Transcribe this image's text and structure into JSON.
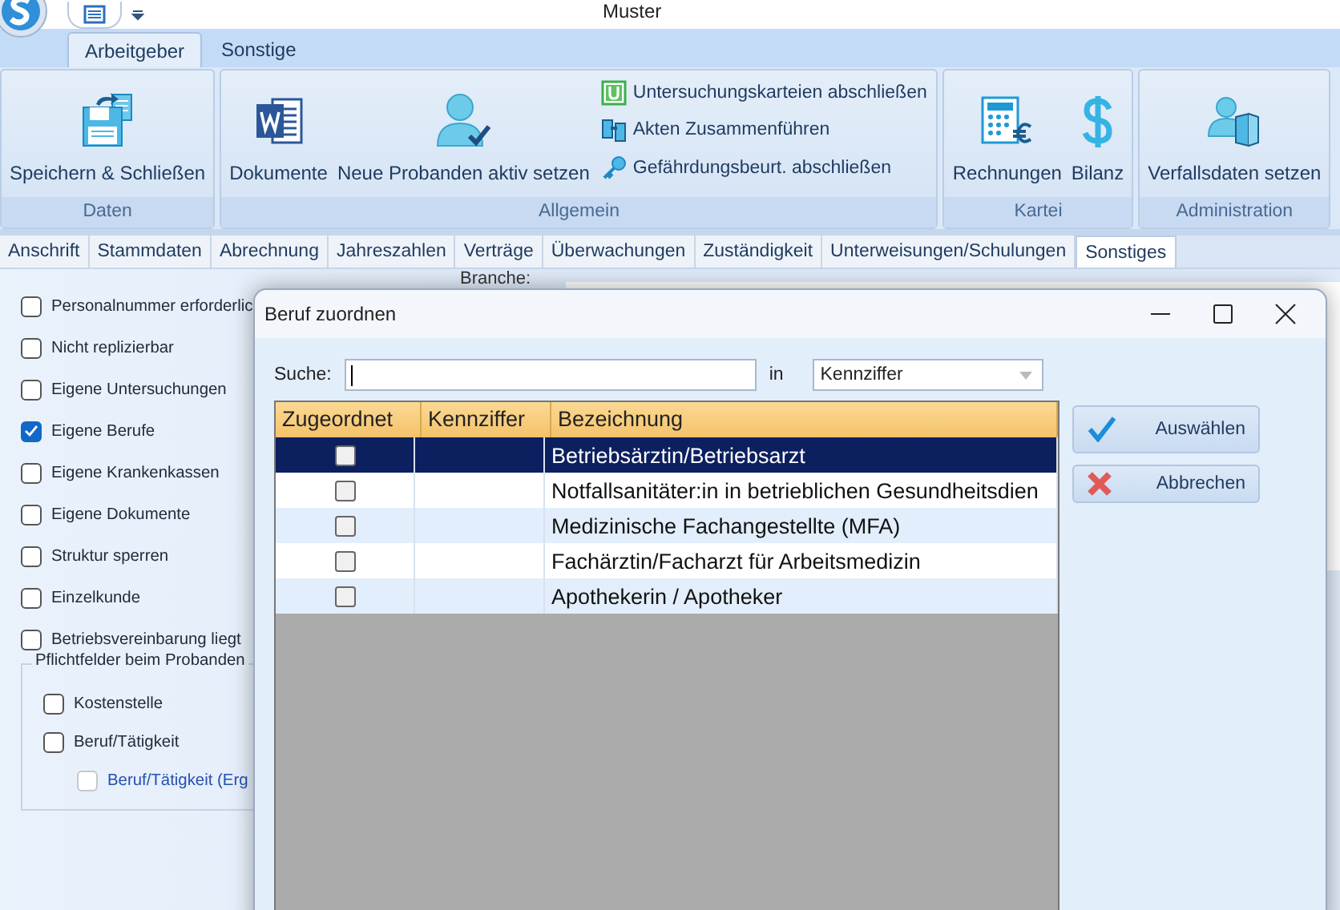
{
  "window": {
    "title": "Muster"
  },
  "ribbon_tabs": [
    {
      "label": "Arbeitgeber",
      "selected": true
    },
    {
      "label": "Sonstige",
      "selected": false
    }
  ],
  "ribbon_groups": [
    {
      "label": "Daten",
      "large": [
        {
          "label": "Speichern & Schließen"
        }
      ]
    },
    {
      "label": "Allgemein",
      "large": [
        {
          "label": "Dokumente"
        },
        {
          "label": "Neue Probanden aktiv setzen"
        }
      ],
      "small": [
        {
          "label": "Untersuchungskarteien abschließen"
        },
        {
          "label": "Akten Zusammenführen"
        },
        {
          "label": "Gefährdungsbeurt. abschließen"
        }
      ]
    },
    {
      "label": "Kartei",
      "large": [
        {
          "label": "Rechnungen"
        },
        {
          "label": "Bilanz"
        }
      ]
    },
    {
      "label": "Administration",
      "large": [
        {
          "label": "Verfallsdaten setzen"
        }
      ]
    }
  ],
  "page_tabs": [
    {
      "label": "Anschrift",
      "selected": false
    },
    {
      "label": "Stammdaten",
      "selected": false
    },
    {
      "label": "Abrechnung",
      "selected": false
    },
    {
      "label": "Jahreszahlen",
      "selected": false
    },
    {
      "label": "Verträge",
      "selected": false
    },
    {
      "label": "Überwachungen",
      "selected": false
    },
    {
      "label": "Zuständigkeit",
      "selected": false
    },
    {
      "label": "Unterweisungen/Schulungen",
      "selected": false
    },
    {
      "label": "Sonstiges",
      "selected": true
    }
  ],
  "options": [
    {
      "label": "Personalnummer erforderlic",
      "checked": false
    },
    {
      "label": "Nicht replizierbar",
      "checked": false
    },
    {
      "label": "Eigene Untersuchungen",
      "checked": false
    },
    {
      "label": "Eigene Berufe",
      "checked": true
    },
    {
      "label": "Eigene Krankenkassen",
      "checked": false
    },
    {
      "label": "Eigene Dokumente",
      "checked": false
    },
    {
      "label": "Struktur sperren",
      "checked": false
    },
    {
      "label": "Einzelkunde",
      "checked": false
    },
    {
      "label": "Betriebsvereinbarung liegt",
      "checked": false
    }
  ],
  "required_fields": {
    "title": "Pflichtfelder beim Probanden",
    "items": [
      {
        "label": "Kostenstelle",
        "checked": false,
        "disabled": false
      },
      {
        "label": "Beruf/Tätigkeit",
        "checked": false,
        "disabled": false,
        "children": [
          {
            "label": "Beruf/Tätigkeit (Erg",
            "checked": false,
            "disabled": true
          }
        ]
      }
    ]
  },
  "branche_label": "Branche:",
  "dialog": {
    "title": "Beruf zuordnen",
    "search": {
      "label": "Suche:",
      "in_label": "in",
      "field": "Kennziffer"
    },
    "columns": [
      "Zugeordnet",
      "Kennziffer",
      "Bezeichnung"
    ],
    "rows": [
      {
        "checked": false,
        "selected": true,
        "bezeichnung": "Betriebsärztin/Betriebsarzt"
      },
      {
        "checked": false,
        "selected": false,
        "bezeichnung": "Notfallsanitäter:in in betrieblichen Gesundheitsdien"
      },
      {
        "checked": false,
        "selected": false,
        "bezeichnung": "Medizinische Fachangestellte (MFA)"
      },
      {
        "checked": false,
        "selected": false,
        "bezeichnung": "Fachärztin/Facharzt für Arbeitsmedizin"
      },
      {
        "checked": false,
        "selected": false,
        "bezeichnung": "Apothekerin / Apotheker"
      }
    ],
    "buttons": [
      {
        "label": "Auswählen",
        "kind": "ok"
      },
      {
        "label": "Abbrechen",
        "kind": "cancel"
      }
    ]
  }
}
